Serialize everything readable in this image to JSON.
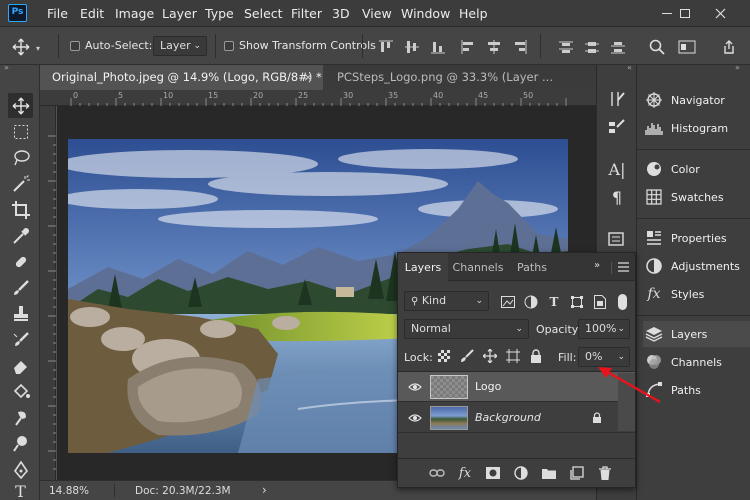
{
  "app": {
    "logo_text": "Ps"
  },
  "menu": [
    "File",
    "Edit",
    "Image",
    "Layer",
    "Type",
    "Select",
    "Filter",
    "3D",
    "View",
    "Window",
    "Help"
  ],
  "options_bar": {
    "auto_select_label": "Auto-Select:",
    "auto_select_target": "Layer",
    "show_transform_label": "Show Transform Controls"
  },
  "doc_tabs": [
    {
      "title": "Original_Photo.jpeg @ 14.9% (Logo, RGB/8#) *",
      "close": "×",
      "active": true
    },
    {
      "title": "PCSteps_Logo.png @ 33.3% (Layer ...",
      "close": "",
      "active": false
    }
  ],
  "ruler_labels": [
    "0",
    "5",
    "10",
    "15",
    "20",
    "25",
    "30",
    "35",
    "40",
    "45",
    "50"
  ],
  "status": {
    "zoom": "14.88%",
    "doc": "Doc: 20.3M/22.3M",
    "arrow": "›"
  },
  "right_panels": [
    {
      "label": "Navigator",
      "icon": "navigator-icon"
    },
    {
      "label": "Histogram",
      "icon": "histogram-icon"
    },
    {
      "label": "Color",
      "icon": "color-icon"
    },
    {
      "label": "Swatches",
      "icon": "swatches-icon"
    },
    {
      "label": "Properties",
      "icon": "properties-icon"
    },
    {
      "label": "Adjustments",
      "icon": "adjustments-icon"
    },
    {
      "label": "Styles",
      "icon": "styles-icon"
    },
    {
      "label": "Layers",
      "icon": "layers-icon"
    },
    {
      "label": "Channels",
      "icon": "channels-icon"
    },
    {
      "label": "Paths",
      "icon": "paths-icon"
    }
  ],
  "layers_panel": {
    "tabs": [
      "Layers",
      "Channels",
      "Paths"
    ],
    "filter_kind": "Kind",
    "blend_mode": "Normal",
    "opacity_label": "Opacity:",
    "opacity_value": "100%",
    "lock_label": "Lock:",
    "fill_label": "Fill:",
    "fill_value": "0%",
    "layers": [
      {
        "name": "Logo",
        "visible": true,
        "selected": true
      },
      {
        "name": "Background",
        "visible": true,
        "selected": false,
        "locked": true
      }
    ]
  },
  "colors": {
    "accent_arrow": "#e8141c",
    "selection": "#595959",
    "ps_blue": "#31a8ff"
  }
}
